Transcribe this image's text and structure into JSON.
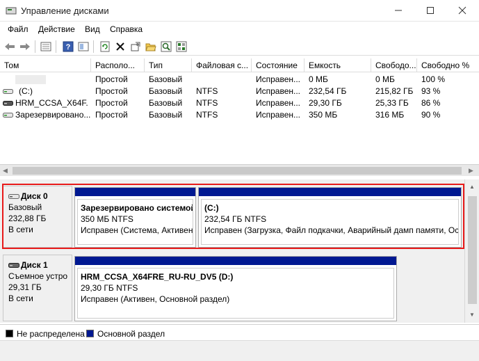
{
  "window": {
    "title": "Управление дисками",
    "icon": "disk-management-icon"
  },
  "menu": [
    "Файл",
    "Действие",
    "Вид",
    "Справка"
  ],
  "toolbar_icons": [
    "back-arrow-icon",
    "forward-arrow-icon",
    "properties-icon",
    "help-icon",
    "view-icon",
    "refresh-icon",
    "delete-icon",
    "settings-icon",
    "open-folder-icon",
    "search-icon",
    "properties-grid-icon"
  ],
  "columns": [
    "Том",
    "Располо...",
    "Тип",
    "Файловая с...",
    "Состояние",
    "Емкость",
    "Свободо...",
    "Свободно %"
  ],
  "volumes": [
    {
      "name": "",
      "layout": "Простой",
      "type": "Базовый",
      "fs": "",
      "status": "Исправен...",
      "capacity": "0 МБ",
      "free": "0 МБ",
      "free_pct": "100 %"
    },
    {
      "name": "(C:)",
      "layout": "Простой",
      "type": "Базовый",
      "fs": "NTFS",
      "status": "Исправен...",
      "capacity": "232,54 ГБ",
      "free": "215,82 ГБ",
      "free_pct": "93 %"
    },
    {
      "name": "HRM_CCSA_X64F...",
      "layout": "Простой",
      "type": "Базовый",
      "fs": "NTFS",
      "status": "Исправен...",
      "capacity": "29,30 ГБ",
      "free": "25,33 ГБ",
      "free_pct": "86 %"
    },
    {
      "name": "Зарезервировано...",
      "layout": "Простой",
      "type": "Базовый",
      "fs": "NTFS",
      "status": "Исправен...",
      "capacity": "350 МБ",
      "free": "316 МБ",
      "free_pct": "90 %"
    }
  ],
  "disks": [
    {
      "name": "Диск 0",
      "type": "Базовый",
      "size": "232,88 ГБ",
      "status": "В сети",
      "partitions": [
        {
          "name": "Зарезервировано системой",
          "size_fs": "350 МБ NTFS",
          "status": "Исправен (Система, Активен,"
        },
        {
          "name": "(C:)",
          "size_fs": "232,54 ГБ NTFS",
          "status": "Исправен (Загрузка, Файл подкачки, Аварийный дамп памяти, Ос"
        }
      ]
    },
    {
      "name": "Диск 1",
      "type": "Съемное устро",
      "size": "29,31 ГБ",
      "status": "В сети",
      "partitions": [
        {
          "name": "HRM_CCSA_X64FRE_RU-RU_DV5  (D:)",
          "size_fs": "29,30 ГБ NTFS",
          "status": "Исправен (Активен, Основной раздел)"
        }
      ]
    }
  ],
  "legend": [
    {
      "label": "Не распределена",
      "color": "#000000"
    },
    {
      "label": "Основной раздел",
      "color": "#001891"
    }
  ],
  "colors": {
    "partition_bar": "#001891",
    "highlight": "#e81a1a"
  }
}
